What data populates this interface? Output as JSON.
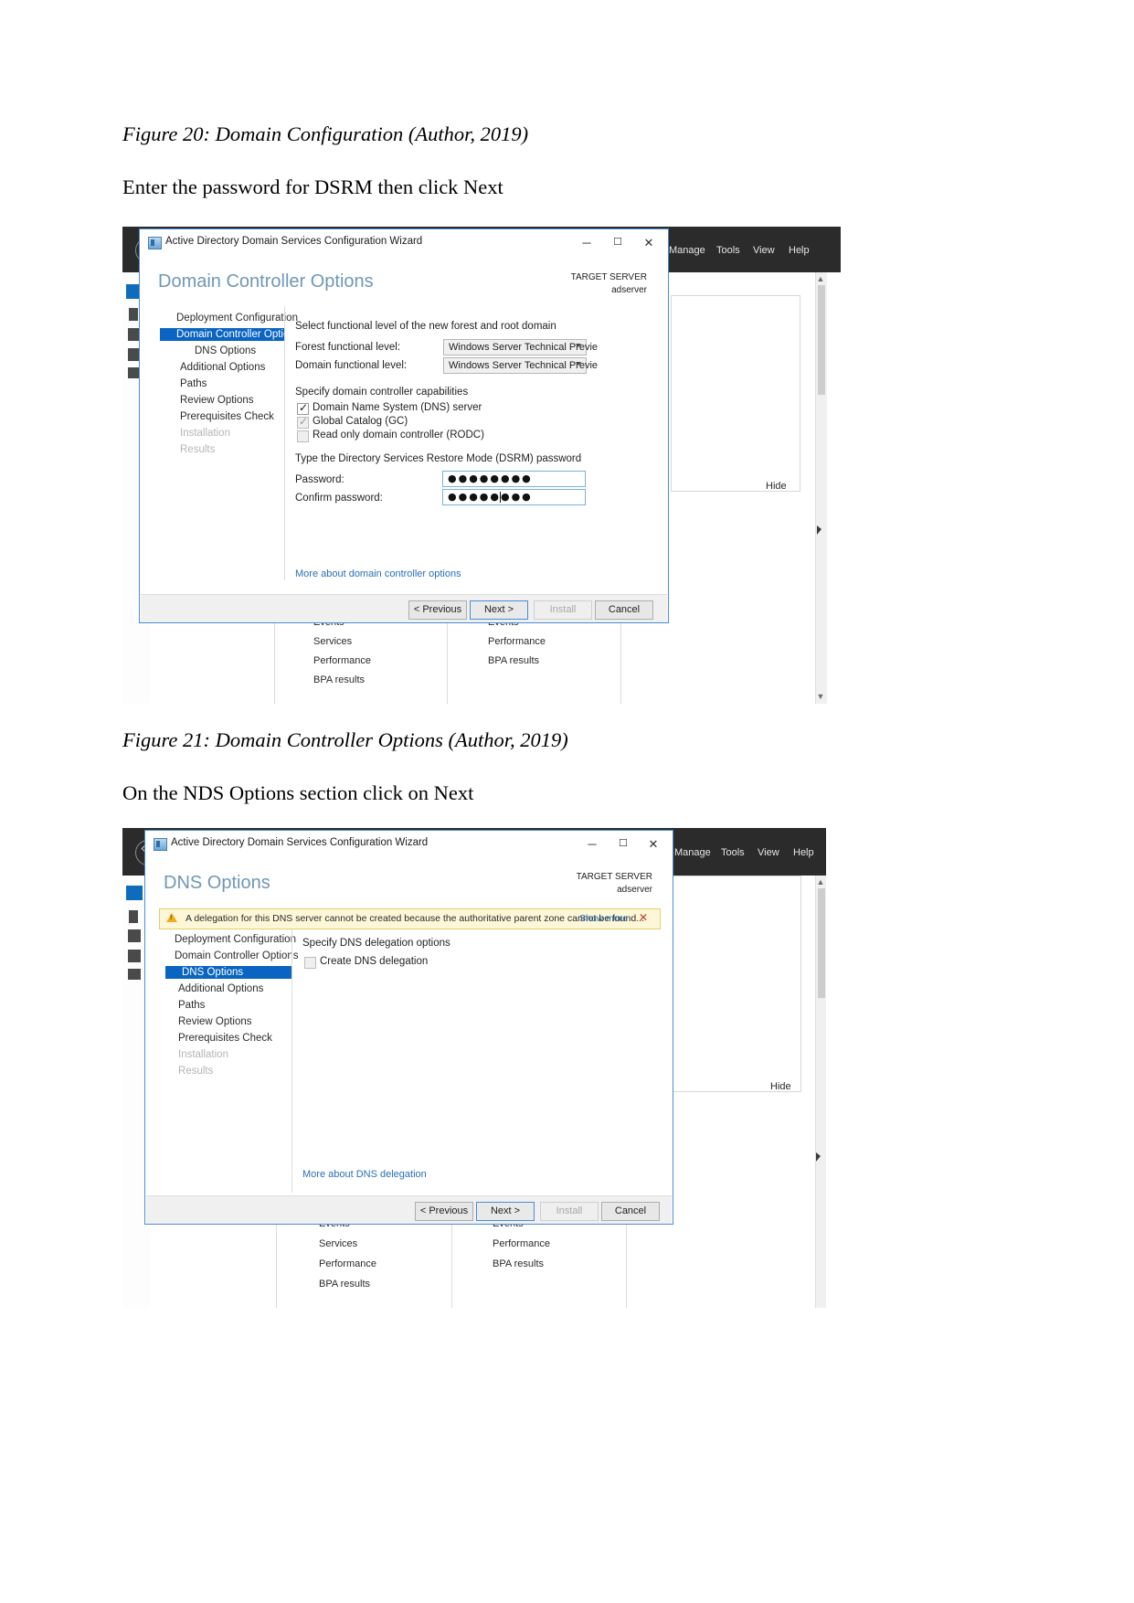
{
  "document": {
    "caption_1": "Figure 20: Domain Configuration (Author, 2019)",
    "para_1": "Enter the password for DSRM then click Next",
    "caption_2": "Figure 21: Domain Controller Options (Author, 2019)",
    "para_2": "On the NDS Options section click on Next"
  },
  "server_manager": {
    "menu": [
      "Manage",
      "Tools",
      "View",
      "Help"
    ],
    "hide_label": "Hide",
    "columns": [
      [
        "Events",
        "Services",
        "Performance",
        "BPA results"
      ],
      [
        "Events",
        "Performance",
        "BPA results"
      ]
    ]
  },
  "wizard_dcoptions": {
    "titlebar": {
      "title": "Active Directory Domain Services Configuration Wizard",
      "minimize": "─",
      "maximize": "☐",
      "close": "✕"
    },
    "heading": "Domain Controller Options",
    "target_server_label": "TARGET SERVER",
    "target_server_name": "adserver",
    "nav_items": [
      "Deployment Configuration",
      "Domain Controller Options",
      "DNS Options",
      "Additional Options",
      "Paths",
      "Review Options",
      "Prerequisites Check",
      "Installation",
      "Results"
    ],
    "nav_selected_index": 1,
    "nav_dim_from_index": 7,
    "section_functional": "Select functional level of the new forest and root domain",
    "forest_level_label": "Forest functional level:",
    "forest_level_value": "Windows Server Technical Previe",
    "domain_level_label": "Domain functional level:",
    "domain_level_value": "Windows Server Technical Previe",
    "section_capabilities": "Specify domain controller capabilities",
    "capabilities": [
      {
        "label": "Domain Name System (DNS) server",
        "checked": true,
        "disabled": false
      },
      {
        "label": "Global Catalog (GC)",
        "checked": true,
        "disabled": true
      },
      {
        "label": "Read only domain controller (RODC)",
        "checked": false,
        "disabled": true
      }
    ],
    "section_dsrm": "Type the Directory Services Restore Mode (DSRM) password",
    "password_label": "Password:",
    "password_value": "●●●●●●●●",
    "confirm_label": "Confirm password:",
    "confirm_value": "●●●●●●●●",
    "more_link": "More about domain controller options",
    "buttons": {
      "previous": "< Previous",
      "next": "Next >",
      "install": "Install",
      "cancel": "Cancel"
    }
  },
  "wizard_dnsoptions": {
    "titlebar": {
      "title": "Active Directory Domain Services Configuration Wizard",
      "minimize": "─",
      "maximize": "☐",
      "close": "✕"
    },
    "heading": "DNS Options",
    "target_server_label": "TARGET SERVER",
    "target_server_name": "adserver",
    "warning_text": "A delegation for this DNS server cannot be created because the authoritative parent zone cannot be found...",
    "warning_show_more": "Show more",
    "warning_close": "✕",
    "nav_items": [
      "Deployment Configuration",
      "Domain Controller Options",
      "DNS Options",
      "Additional Options",
      "Paths",
      "Review Options",
      "Prerequisites Check",
      "Installation",
      "Results"
    ],
    "nav_selected_index": 2,
    "nav_dim_from_index": 7,
    "section_delegation": "Specify DNS delegation options",
    "delegation_checkbox": {
      "label": "Create DNS delegation",
      "checked": false,
      "disabled": true
    },
    "more_link": "More about DNS delegation",
    "buttons": {
      "previous": "< Previous",
      "next": "Next >",
      "install": "Install",
      "cancel": "Cancel"
    }
  },
  "colors": {
    "accent_blue": "#0a64c2",
    "heading_blue": "#6f98b5",
    "warning_bg": "#fdf7d8",
    "warning_border": "#e2cf6e",
    "dark_bar": "#2b2b2b"
  }
}
